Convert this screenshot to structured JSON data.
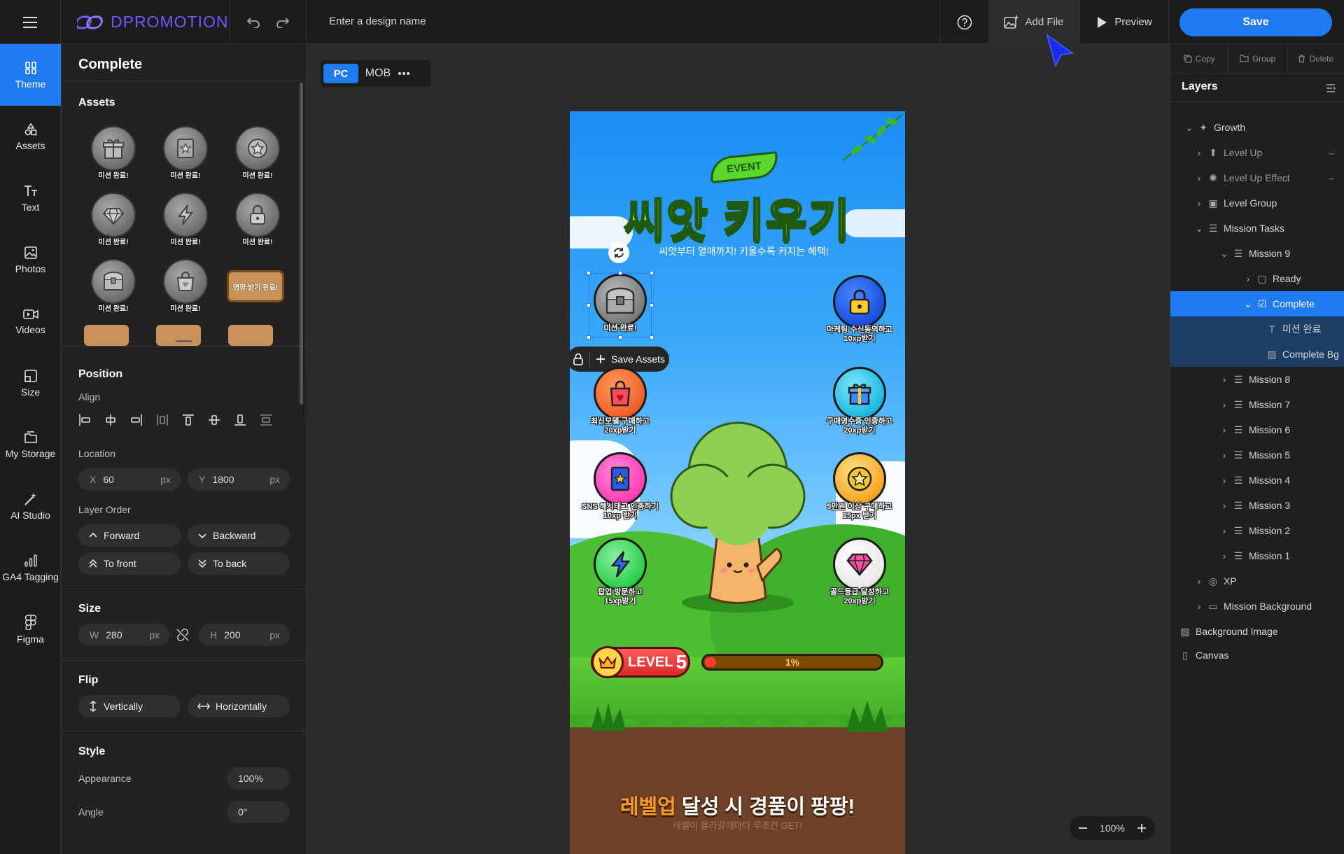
{
  "app": {
    "brand": "DPROMOTION",
    "design_name_placeholder": "Enter a design name"
  },
  "topbar": {
    "add_file": "Add File",
    "preview": "Preview",
    "save": "Save"
  },
  "nav": [
    {
      "label": "Theme",
      "icon": "theme-icon"
    },
    {
      "label": "Assets",
      "icon": "assets-icon"
    },
    {
      "label": "Text",
      "icon": "text-icon"
    },
    {
      "label": "Photos",
      "icon": "photos-icon"
    },
    {
      "label": "Videos",
      "icon": "videos-icon"
    },
    {
      "label": "Size",
      "icon": "size-icon"
    },
    {
      "label": "My Storage",
      "icon": "storage-icon"
    },
    {
      "label": "AI Studio",
      "icon": "ai-studio-icon"
    },
    {
      "label": "GA4 Tagging",
      "icon": "ga4-icon"
    },
    {
      "label": "Figma",
      "icon": "figma-icon"
    }
  ],
  "props": {
    "title": "Complete",
    "assets_title": "Assets",
    "asset_caption": "미션 완료!",
    "asset_special_caption": "영양 받기 완료!",
    "position_title": "Position",
    "align_label": "Align",
    "location_label": "Location",
    "x_prefix": "X",
    "x_value": "60",
    "y_prefix": "Y",
    "y_value": "1800",
    "unit": "px",
    "layer_order_label": "Layer Order",
    "forward": "Forward",
    "backward": "Backward",
    "to_front": "To front",
    "to_back": "To back",
    "size_title": "Size",
    "w_prefix": "W",
    "w_value": "280",
    "h_prefix": "H",
    "h_value": "200",
    "flip_title": "Flip",
    "vertically": "Vertically",
    "horizontally": "Horizontally",
    "style_title": "Style",
    "appearance_label": "Appearance",
    "appearance_value": "100%",
    "angle_label": "Angle",
    "angle_value": "0°"
  },
  "canvas": {
    "device_pc": "PC",
    "device_mob": "MOB",
    "zoom": "100%",
    "event_tag": "EVENT",
    "title": "씨앗 키우기",
    "subtitle": "씨앗부터 열매까지! 키울수록 커지는 혜택!",
    "save_assets": "Save Assets",
    "missions": [
      {
        "label": "미션 완료!",
        "color": "#8a8a8a"
      },
      {
        "label": "마케팅 수신동의하고\n10xp받기",
        "color": "#1a4fe0"
      },
      {
        "label": "최신모델 구매하고\n20xp받기",
        "color": "#f0602a"
      },
      {
        "label": "구매영수증 인증하고\n20xp받기",
        "color": "#1fb8e0"
      },
      {
        "label": "SNS 해시태그 인증하기\n10xp 받기",
        "color": "#ff3fb4"
      },
      {
        "label": "5만원 이상 구매하고\n15px 받기",
        "color": "#f5a623"
      },
      {
        "label": "팝업 방문하고\n15xp받기",
        "color": "#2ccf4a"
      },
      {
        "label": "골드등급 달성하고\n20xp받기",
        "color": "#e8e8e8"
      }
    ],
    "level_label": "LEVEL",
    "level_value": "5",
    "xp_percent": "1%",
    "xp_fraction": 0.01,
    "bottom_highlight": "레벨업",
    "bottom_title_rest": " 달성 시 경품이 팡팡!",
    "bottom_sub": "레벨이 올라갈때마다 무조건 GET!"
  },
  "layers_panel": {
    "copy": "Copy",
    "group": "Group",
    "delete": "Delete",
    "title": "Layers",
    "items": [
      {
        "label": "Growth"
      },
      {
        "label": "Level Up"
      },
      {
        "label": "Level Up Effect"
      },
      {
        "label": "Level Group"
      },
      {
        "label": "Mission Tasks"
      },
      {
        "label": "Mission 9"
      },
      {
        "label": "Ready"
      },
      {
        "label": "Complete"
      },
      {
        "label": "미션 완료"
      },
      {
        "label": "Complete Bg"
      },
      {
        "label": "Mission 8"
      },
      {
        "label": "Mission 7"
      },
      {
        "label": "Mission 6"
      },
      {
        "label": "Mission 5"
      },
      {
        "label": "Mission 4"
      },
      {
        "label": "Mission 3"
      },
      {
        "label": "Mission 2"
      },
      {
        "label": "Mission 1"
      },
      {
        "label": "XP"
      },
      {
        "label": "Mission Background"
      },
      {
        "label": "Background Image"
      },
      {
        "label": "Canvas"
      }
    ]
  },
  "colors": {
    "accent": "#1f7bf0",
    "brand": "#6e5bff",
    "panel": "#222222",
    "canvas": "#2b2b2b"
  }
}
